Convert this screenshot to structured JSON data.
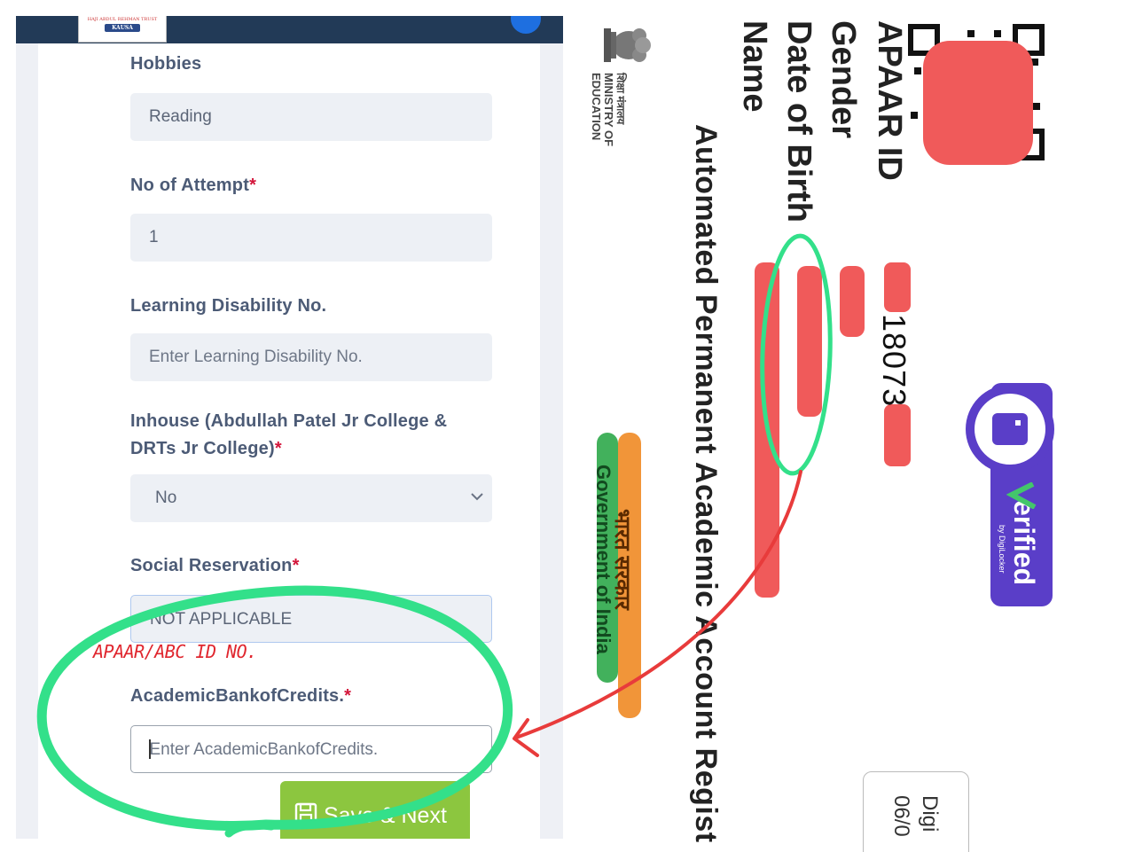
{
  "form": {
    "fields": {
      "hobbies": {
        "label": "Hobbies",
        "value": "Reading"
      },
      "attempts": {
        "label": "No of Attempt",
        "required_mark": "*",
        "value": "1"
      },
      "learning_disability": {
        "label": "Learning Disability No.",
        "placeholder": "Enter Learning Disability No."
      },
      "inhouse": {
        "label_line1": "Inhouse (Abdullah Patel Jr College &",
        "label_line2": "DRTs Jr College)",
        "required_mark": "*",
        "value": "No"
      },
      "social_reservation": {
        "label": "Social Reservation",
        "required_mark": "*",
        "value": "NOT APPLICABLE"
      },
      "abc": {
        "label": "AcademicBankofCredits.",
        "required_mark": "*",
        "placeholder": "Enter AcademicBankofCredits."
      }
    },
    "save_button": {
      "label": "Save & Next",
      "icon": "floppy-disk-icon"
    },
    "logo_text": {
      "line1": "HAJI ABDUL REHMAN TRUST",
      "line2": "KAUSA"
    }
  },
  "annotation": {
    "handwritten_note": "APAAR/ABC ID NO.",
    "colors": {
      "highlight": "#33e08a",
      "note": "#e0262e",
      "arrow": "#e83b3b"
    }
  },
  "apaar_card": {
    "title": "Automated Permanent Academic Account Regist",
    "labels": {
      "name": "Name",
      "dob": "Date of Birth",
      "gender": "Gender",
      "apaar_id": "APAAR ID"
    },
    "apaar_id_partial": "18073",
    "ministry": {
      "hindi": "शिक्षा मंत्रालय",
      "line1": "MINISTRY OF",
      "line2": "EDUCATION"
    },
    "government": {
      "hindi": "भारत सरकार",
      "english": "Government of India"
    },
    "verified_badge": {
      "text": "erified",
      "by": "by DigiLocker"
    },
    "issue_box": {
      "line1": "Digi",
      "line2": "06/0"
    },
    "colors": {
      "redaction": "#f05a5a",
      "badge": "#5a3ec8",
      "saffron": "#f08a24",
      "green": "#2ea84a"
    }
  }
}
